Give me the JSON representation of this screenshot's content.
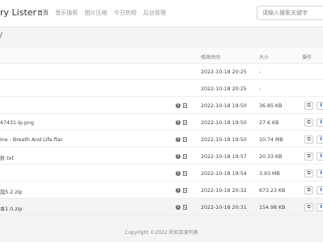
{
  "header": {
    "brand": "ry Lister",
    "nav": [
      "首页",
      "音乐搜索",
      "图片压缩",
      "今日热榜",
      "后台管理"
    ],
    "search_placeholder": "请输入搜索关键字"
  },
  "breadcrumb": "/",
  "table": {
    "columns": [
      "修改时间",
      "大小",
      "操作"
    ],
    "rows": [
      {
        "name": "",
        "time": "2022-10-18 20:25",
        "size": "-",
        "is_file": false
      },
      {
        "name": "",
        "time": "2022-10-18 20:25",
        "size": "-",
        "is_file": false
      },
      {
        "name": "",
        "time": "2022-10-18 19:50",
        "size": "36.85 KB",
        "is_file": true
      },
      {
        "name": "47431-lp.png",
        "time": "2022-10-18 19:50",
        "size": "27.6 KB",
        "is_file": true
      },
      {
        "name": "ine - Breath And Life.flac",
        "time": "2022-10-18 19:50",
        "size": "10.74 MB",
        "is_file": true
      },
      {
        "name": "折.txt",
        "time": "2022-10-18 19:57",
        "size": "20.33 KB",
        "is_file": true
      },
      {
        "name": "",
        "time": "2022-10-18 19:54",
        "size": "3.93 MB",
        "is_file": true
      },
      {
        "name": "設5.2.zip",
        "time": "2022-10-18 20:32",
        "size": "673.23 KB",
        "is_file": true
      },
      {
        "name": "本1.0.zip",
        "time": "2022-10-18 20:31",
        "size": "154.98 KB",
        "is_file": true
      }
    ]
  },
  "icons": {
    "info": "info-icon",
    "qr": "qrcode-icon",
    "copy": "copy-icon",
    "download": "download-icon"
  },
  "footer": "Copyright ©2022 彩虹目录列表"
}
